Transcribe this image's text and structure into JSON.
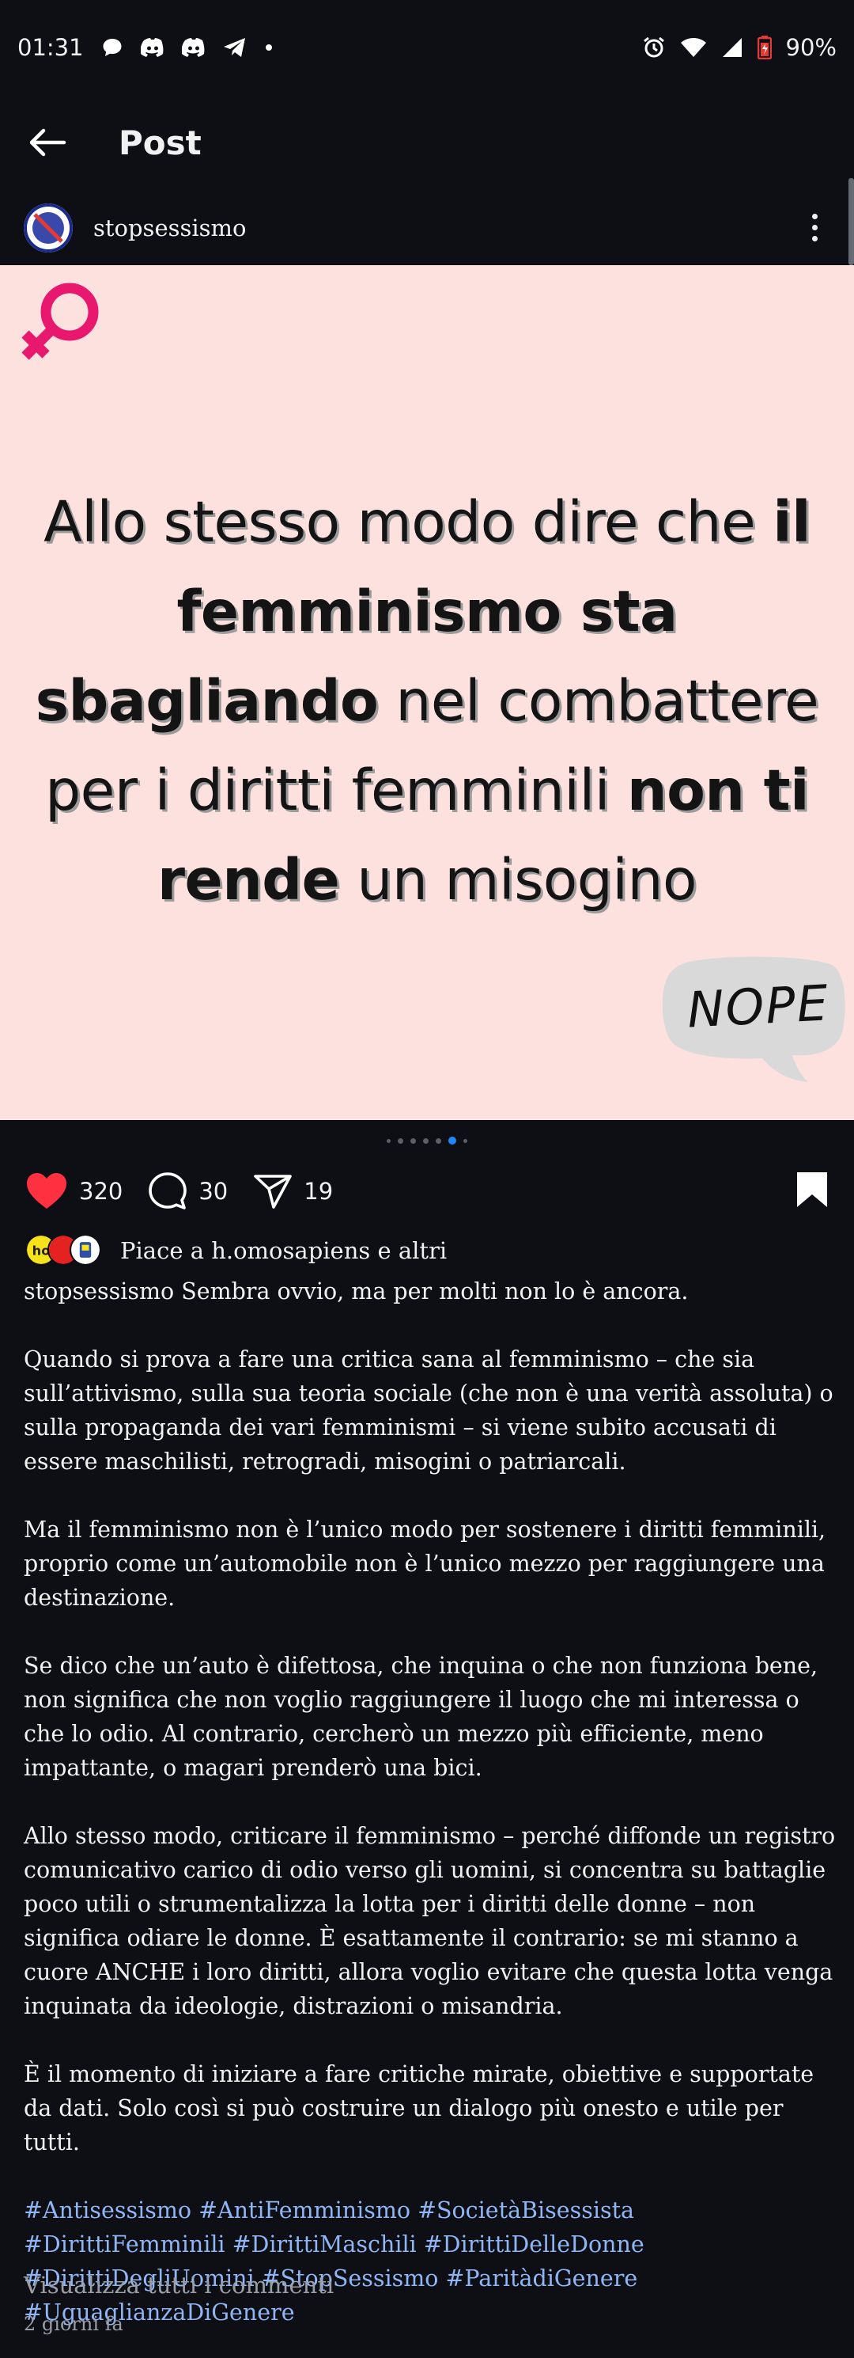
{
  "status_bar": {
    "time": "01:31",
    "battery": "90%"
  },
  "app_bar": {
    "title": "Post"
  },
  "author": {
    "username": "stopsessismo"
  },
  "post_image": {
    "text_parts": [
      {
        "text": "Allo stesso modo dire che ",
        "bold": false
      },
      {
        "text": "il femminismo sta sbagliando",
        "bold": true
      },
      {
        "text": " nel combattere per i diritti femminili ",
        "bold": false
      },
      {
        "text": "non ti rende",
        "bold": true
      },
      {
        "text": " un misogino",
        "bold": false
      }
    ],
    "bubble_text": "NOPE",
    "colors": {
      "background": "#fde1df",
      "venus": "#e8186e"
    }
  },
  "carousel": {
    "count": 7,
    "active_index": 5
  },
  "actions": {
    "likes": "320",
    "comments": "30",
    "shares": "19"
  },
  "likes_row": {
    "text": "Piace a h.omosapiens e altri"
  },
  "caption": {
    "first_line": "stopsessismo Sembra ovvio, ma per molti non lo è ancora.",
    "paragraphs": [
      "Quando si prova a fare una critica sana al femminismo – che sia sull’attivismo, sulla sua teoria sociale (che non è una verità assoluta) o sulla propaganda dei vari femminismi – si viene subito accusati di essere maschilisti, retrogradi, misogini o patriarcali.",
      "Ma il femminismo non è l’unico modo per sostenere i diritti femminili, proprio come un’automobile non è l’unico mezzo per raggiungere una destinazione.",
      "Se dico che un’auto è difettosa, che inquina o che non funziona bene, non significa che non voglio raggiungere il luogo che mi interessa o che lo odio. Al contrario, cercherò un mezzo più efficiente, meno impattante, o magari prenderò una bici.",
      "Allo stesso modo, criticare il femminismo – perché diffonde un registro comunicativo carico di odio verso gli uomini, si concentra su battaglie poco utili o strumentalizza la lotta per i diritti delle donne – non significa odiare le donne. È esattamente il contrario: se mi stanno a cuore ANCHE i loro diritti, allora voglio evitare che questa lotta venga inquinata da ideologie, distrazioni o misandria.",
      "È il momento di iniziare a fare critiche mirate, obiettive e supportate da dati. Solo così si può costruire un dialogo più onesto e utile per tutti."
    ],
    "hashtags": "#Antisessismo #AntiFemminismo #SocietàBisessista #DirittiFemminili #DirittiMaschili #DirittiDelleDonne #DirittiDegliUomini #StopSessismo #ParitàdiGenere #UguaglianzaDiGenere"
  },
  "view_comments": "Visualizza tutti i commenti",
  "time_ago": "2 giorni fa"
}
